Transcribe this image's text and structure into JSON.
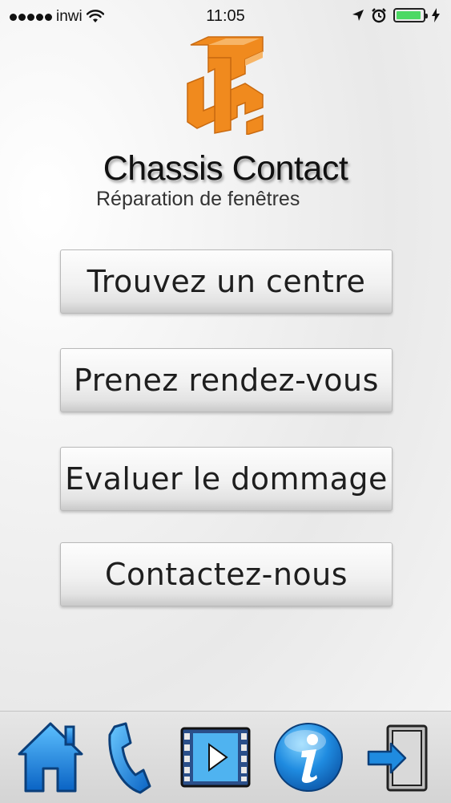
{
  "status_bar": {
    "carrier": "inwi",
    "time": "11:05",
    "battery_color": "#4cd964"
  },
  "brand": {
    "title": "Chassis Contact",
    "subtitle": "Réparation de fenêtres",
    "logo_color": "#f08a1e"
  },
  "menu": [
    {
      "label": "Trouvez un centre"
    },
    {
      "label": "Prenez rendez-vous"
    },
    {
      "label": "Evaluer le dommage"
    },
    {
      "label": "Contactez-nous"
    }
  ],
  "tab_bar": {
    "items": [
      {
        "icon": "home-icon"
      },
      {
        "icon": "phone-icon"
      },
      {
        "icon": "video-icon"
      },
      {
        "icon": "info-icon"
      },
      {
        "icon": "logout-icon"
      }
    ],
    "accent": "#1f8be0"
  }
}
